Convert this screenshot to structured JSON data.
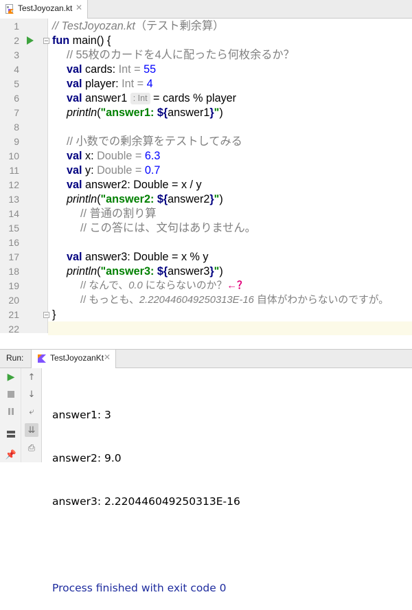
{
  "editor_tab": {
    "file_name": "TestJoyozan.kt",
    "close_glyph": "✕"
  },
  "gutter": {
    "line_numbers": [
      "1",
      "2",
      "3",
      "4",
      "5",
      "6",
      "7",
      "8",
      "9",
      "10",
      "11",
      "12",
      "13",
      "14",
      "15",
      "16",
      "17",
      "18",
      "19",
      "20",
      "21",
      "22"
    ]
  },
  "code": {
    "l1_comment": "// TestJoyozan.kt",
    "l1_comment_jp": "（テスト剰余算）",
    "l2_fun": "fun",
    "l2_rest": " main() {",
    "l3_comment": "// 55枚のカードを4人に配ったら何枚余るか？",
    "l4_val": "val",
    "l4_name": " cards",
    "l4_colon": ": ",
    "l4_type": "Int",
    "l4_eq": " = ",
    "l4_num": "55",
    "l5_val": "val",
    "l5_name": " player",
    "l5_colon": ": ",
    "l5_type": "Int",
    "l5_eq": " = ",
    "l5_num": "4",
    "l6_val": "val",
    "l6_name": " answer1",
    "l6_hint": ": Int",
    "l6_rest": " = cards % player",
    "l7_fn": "println",
    "l7_open": "(",
    "l7_str": "\"answer1: ",
    "l7_tmpl_open": "${",
    "l7_var": "answer1",
    "l7_tmpl_close": "}",
    "l7_str_end": "\"",
    "l7_close": ")",
    "l9_comment": "// 小数での剰余算をテストしてみる",
    "l10_val": "val",
    "l10_name": " x",
    "l10_colon": ": ",
    "l10_type": "Double",
    "l10_eq": " = ",
    "l10_num": "6.3",
    "l11_val": "val",
    "l11_name": " y",
    "l11_colon": ": ",
    "l11_type": "Double",
    "l11_eq": " = ",
    "l11_num": "0.7",
    "l12_val": "val",
    "l12_rest": " answer2: Double = x / y",
    "l13_fn": "println",
    "l13_open": "(",
    "l13_str": "\"answer2: ",
    "l13_tmpl_open": "${",
    "l13_var": "answer2",
    "l13_tmpl_close": "}",
    "l13_str_end": "\"",
    "l13_close": ")",
    "l14_comment": "// 普通の割り算",
    "l15_comment": "// この答には、文句はありません。",
    "l17_val": "val",
    "l17_rest": " answer3: Double = x % y",
    "l18_fn": "println",
    "l18_open": "(",
    "l18_str": "\"answer3: ",
    "l18_tmpl_open": "${",
    "l18_var": "answer3",
    "l18_tmpl_close": "}",
    "l18_str_end": "\"",
    "l18_close": ")",
    "l19_comment_a": "// なんで、",
    "l19_comment_b": "0.0",
    "l19_comment_c": " にならないのか？",
    "l19_arrow": "←？",
    "l20_comment_a": "// もっとも、",
    "l20_comment_b": "2.220446049250313E-16",
    "l20_comment_c": " 自体がわからないのですが。",
    "l21_brace": "}"
  },
  "run_panel": {
    "title": "Run:",
    "tab_label": "TestJoyozanKt",
    "close_glyph": "✕",
    "output": [
      "answer1: 3",
      "answer2: 9.0",
      "answer3: 2.220446049250313E-16",
      "",
      "Process finished with exit code 0"
    ]
  },
  "icons": {
    "editor_tab_icon": "kotlin-file-icon",
    "run_gutter": "run-arrow-icon",
    "run_tab_icon": "kotlin-run-config-icon",
    "toolbar": [
      "rerun-icon",
      "up-arrow-icon",
      "stop-icon",
      "down-arrow-icon",
      "pause-icon",
      "soft-wrap-icon",
      "layout-icon",
      "scroll-to-end-icon",
      "pin-icon",
      "print-icon"
    ]
  },
  "colors": {
    "keyword": "#000080",
    "string": "#008000",
    "number": "#0000ff",
    "comment": "#808080",
    "arrow_annotation": "#e0007a",
    "process_text": "#1d2b9e"
  }
}
